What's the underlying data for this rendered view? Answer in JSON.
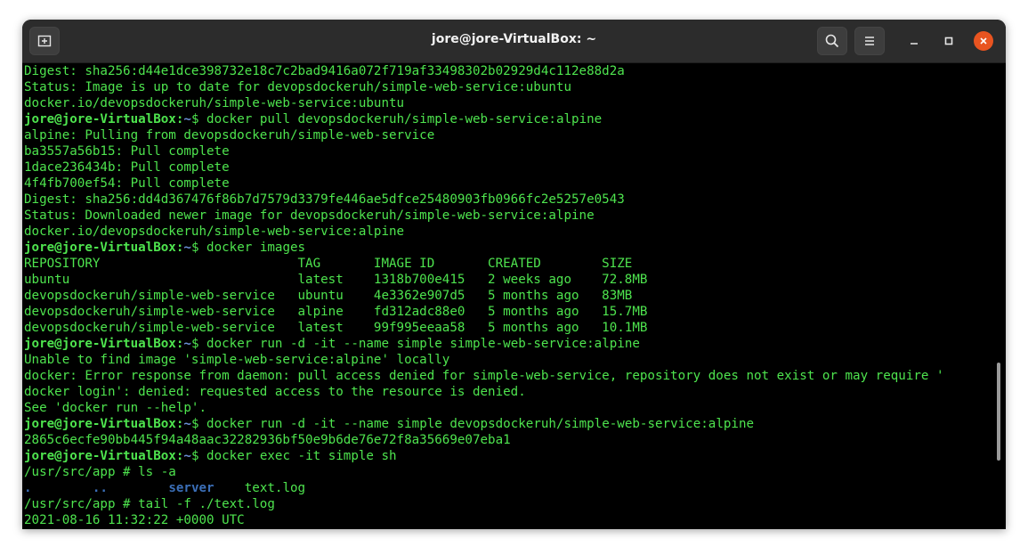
{
  "window": {
    "title": "jore@jore-VirtualBox: ~"
  },
  "toolbar": {
    "new_tab_icon": "new-tab-icon",
    "search_icon": "search-icon",
    "menu_icon": "hamburger-menu-icon",
    "minimize_icon": "minimize-icon",
    "maximize_icon": "maximize-icon",
    "close_icon": "close-icon"
  },
  "colors": {
    "terminal_text": "#4ee44e",
    "path": "#6b8fd6",
    "close": "#e95420"
  },
  "prompt": {
    "user": "jore@jore-VirtualBox",
    "path": "~",
    "symbol": "$"
  },
  "lines": [
    {
      "kind": "out",
      "text": "Digest: sha256:d44e1dce398732e18c7c2bad9416a072f719af33498302b02929d4c112e88d2a"
    },
    {
      "kind": "out",
      "text": "Status: Image is up to date for devopsdockeruh/simple-web-service:ubuntu"
    },
    {
      "kind": "out",
      "text": "docker.io/devopsdockeruh/simple-web-service:ubuntu"
    },
    {
      "kind": "cmd",
      "text": " docker pull devopsdockeruh/simple-web-service:alpine"
    },
    {
      "kind": "out",
      "text": "alpine: Pulling from devopsdockeruh/simple-web-service"
    },
    {
      "kind": "out",
      "text": "ba3557a56b15: Pull complete"
    },
    {
      "kind": "out",
      "text": "1dace236434b: Pull complete"
    },
    {
      "kind": "out",
      "text": "4f4fb700ef54: Pull complete"
    },
    {
      "kind": "out",
      "text": "Digest: sha256:dd4d367476f86b7d7579d3379fe446ae5dfce25480903fb0966fc2e5257e0543"
    },
    {
      "kind": "out",
      "text": "Status: Downloaded newer image for devopsdockeruh/simple-web-service:alpine"
    },
    {
      "kind": "out",
      "text": "docker.io/devopsdockeruh/simple-web-service:alpine"
    },
    {
      "kind": "cmd",
      "text": " docker images"
    },
    {
      "kind": "out",
      "text": "REPOSITORY                          TAG       IMAGE ID       CREATED        SIZE"
    },
    {
      "kind": "out",
      "text": "ubuntu                              latest    1318b700e415   2 weeks ago    72.8MB"
    },
    {
      "kind": "out",
      "text": "devopsdockeruh/simple-web-service   ubuntu    4e3362e907d5   5 months ago   83MB"
    },
    {
      "kind": "out",
      "text": "devopsdockeruh/simple-web-service   alpine    fd312adc88e0   5 months ago   15.7MB"
    },
    {
      "kind": "out",
      "text": "devopsdockeruh/simple-web-service   latest    99f995eeaa58   5 months ago   10.1MB"
    },
    {
      "kind": "cmd",
      "text": " docker run -d -it --name simple simple-web-service:alpine"
    },
    {
      "kind": "out",
      "text": "Unable to find image 'simple-web-service:alpine' locally"
    },
    {
      "kind": "out",
      "text": "docker: Error response from daemon: pull access denied for simple-web-service, repository does not exist or may require '"
    },
    {
      "kind": "out",
      "text": "docker login': denied: requested access to the resource is denied."
    },
    {
      "kind": "out",
      "text": "See 'docker run --help'."
    },
    {
      "kind": "cmd",
      "text": " docker run -d -it --name simple devopsdockeruh/simple-web-service:alpine"
    },
    {
      "kind": "out",
      "text": "2865c6ecfe90bb445f94a48aac32282936bf50e9b6de76e72f8a35669e07eba1"
    },
    {
      "kind": "cmd",
      "text": " docker exec -it simple sh"
    },
    {
      "kind": "out",
      "text": "/usr/src/app # ls -a"
    },
    {
      "kind": "ls",
      "dirs": [
        ".",
        "..",
        "server"
      ],
      "file": "text.log"
    },
    {
      "kind": "out",
      "text": "/usr/src/app # tail -f ./text.log"
    },
    {
      "kind": "out",
      "text": "2021-08-16 11:32:22 +0000 UTC"
    }
  ]
}
